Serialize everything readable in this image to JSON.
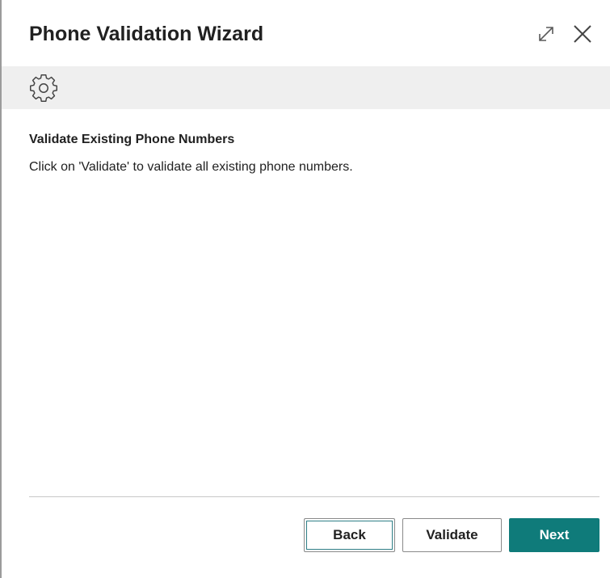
{
  "dialog": {
    "title": "Phone Validation Wizard"
  },
  "header": {
    "icons": [
      "expand-icon",
      "close-icon"
    ]
  },
  "banner": {
    "icon": "gear-icon"
  },
  "step": {
    "title": "Validate Existing Phone Numbers",
    "description": "Click on 'Validate' to validate all existing phone numbers."
  },
  "footer": {
    "back_label": "Back",
    "validate_label": "Validate",
    "next_label": "Next"
  },
  "colors": {
    "accent": "#0f7b7a",
    "banner_bg": "#efefef",
    "text": "#212121"
  }
}
